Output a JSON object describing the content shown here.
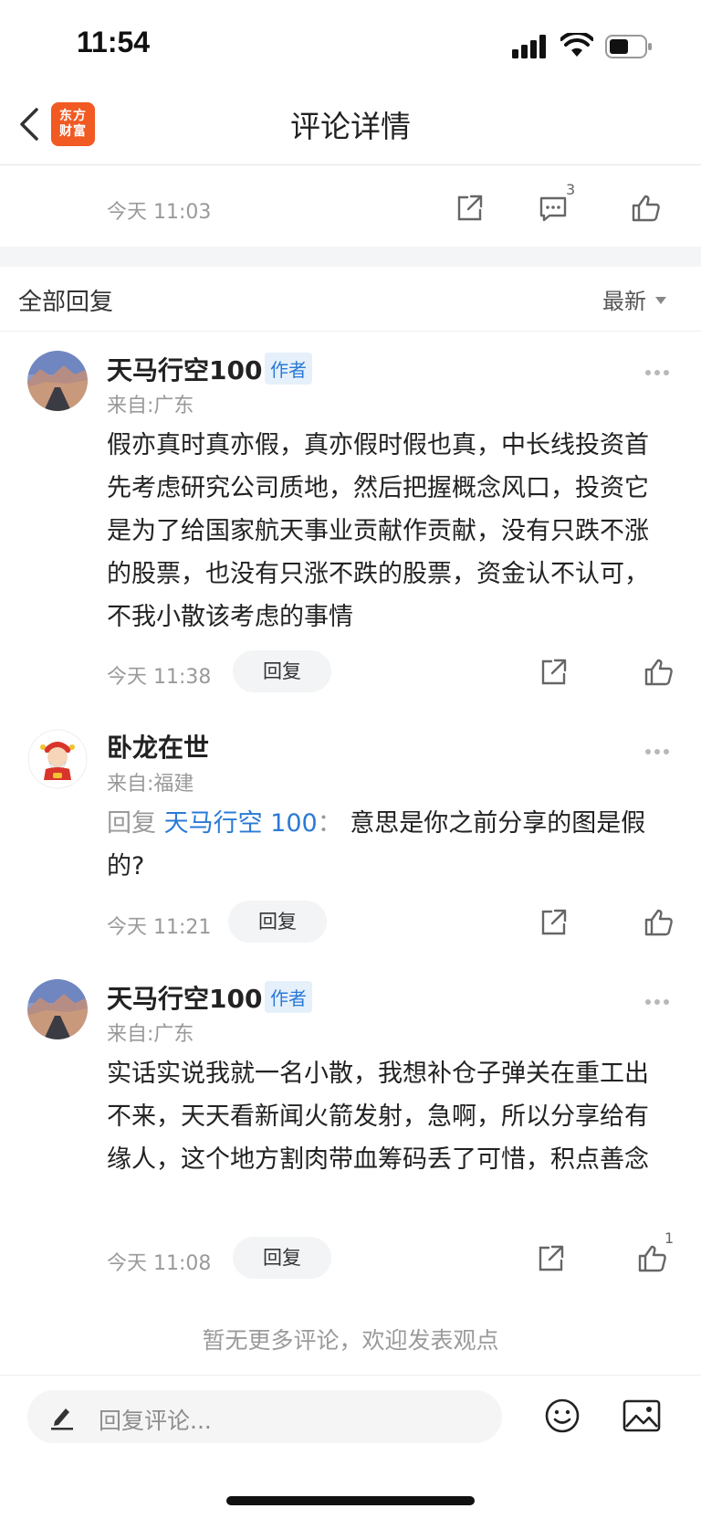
{
  "status_bar": {
    "time": "11:54"
  },
  "nav": {
    "title": "评论详情",
    "logo_line1": "东方",
    "logo_line2": "财富"
  },
  "main_comment": {
    "time": "今天 11:03",
    "comment_count": "3"
  },
  "replies_section": {
    "title": "全部回复",
    "sort_label": "最新"
  },
  "comments": [
    {
      "username": "天马行空100",
      "badge": "作者",
      "from": "来自:广东",
      "text": "假亦真时真亦假，真亦假时假也真，中长线投资首先考虑研究公司质地，然后把握概念风口，投资它是为了给国家航天事业贡献作贡献，没有只跌不涨的股票，也没有只涨不跌的股票，资金认不认可，不我小散该考虑的事情",
      "time": "今天 11:38",
      "reply_label": "回复"
    },
    {
      "username": "卧龙在世",
      "from": "来自:福建",
      "reply_prefix": "回复",
      "reply_target": "天马行空 100",
      "reply_sep": "：",
      "text": "意思是你之前分享的图是假的?",
      "time": "今天 11:21",
      "reply_label": "回复"
    },
    {
      "username": "天马行空100",
      "badge": "作者",
      "from": "来自:广东",
      "text": "实话实说我就一名小散，我想补仓子弹关在重工出不来，天天看新闻火箭发射，急啊，所以分享给有缘人，这个地方割肉带血筹码丢了可惜，积点善念",
      "time": "今天 11:08",
      "reply_label": "回复",
      "like_count": "1"
    }
  ],
  "footer": {
    "no_more": "暂无更多评论，欢迎发表观点"
  },
  "input_bar": {
    "placeholder": "回复评论..."
  },
  "colors": {
    "accent_blue": "#2a7ad6",
    "logo_orange": "#f15a22"
  },
  "icons": [
    "chevron-left-icon",
    "share-icon",
    "comment-icon",
    "thumb-up-icon",
    "more-icon",
    "pen-icon",
    "emoji-icon",
    "image-icon"
  ]
}
